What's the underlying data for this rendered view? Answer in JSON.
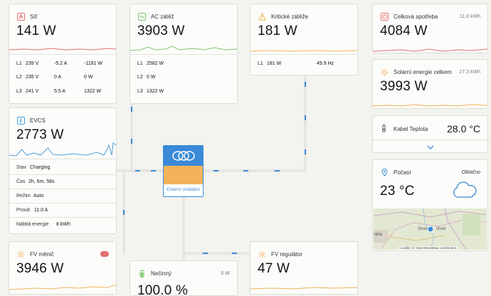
{
  "grid": {
    "title": "Síť",
    "value": "141 W",
    "rows": [
      {
        "phase": "L1",
        "volt": "239 V",
        "amp": "-5.2 A",
        "watt": "-1181 W"
      },
      {
        "phase": "L2",
        "volt": "235 V",
        "amp": "0 A",
        "watt": "0 W"
      },
      {
        "phase": "L3",
        "volt": "241 V",
        "amp": "5.5 A",
        "watt": "1322 W"
      }
    ]
  },
  "ac_load": {
    "title": "AC zátěž",
    "value": "3903 W",
    "rows": [
      {
        "phase": "L1",
        "watt": "2582 W"
      },
      {
        "phase": "L2",
        "watt": "0 W"
      },
      {
        "phase": "L3",
        "watt": "1322 W"
      }
    ]
  },
  "critical_load": {
    "title": "Kritické zátěže",
    "value": "181 W",
    "rows": [
      {
        "phase": "L1",
        "watt": "181 W",
        "freq": "49.9 Hz"
      }
    ]
  },
  "total_consumption": {
    "title": "Celková spotřeba",
    "value": "4084 W",
    "energy": "11.8 kWh"
  },
  "solar_total": {
    "title": "Solární energie celkem",
    "value": "3993 W",
    "energy": "27.3 kWh"
  },
  "cable_temp": {
    "title": "Kabel Teplota",
    "value": "28.0 °C"
  },
  "weather": {
    "title": "Počasí",
    "condition": "Oblačno",
    "temp": "23 °C",
    "map_attrib": "Leaflet | © OpenStreetMap contributors",
    "map_labels": [
      "raha",
      "Seve",
      "chod"
    ]
  },
  "evcs": {
    "title": "EVCS",
    "value": "2773 W",
    "rows": [
      {
        "label": "Stav",
        "value": "Charging"
      },
      {
        "label": "Čas",
        "value": "2h, 6m, 58s"
      },
      {
        "label": "Režim",
        "value": "Auto"
      },
      {
        "label": "Proud",
        "value": "11.0 A"
      },
      {
        "label": "Nabitá energie",
        "value": "8 kWh"
      }
    ]
  },
  "pv_inverter": {
    "title": "FV měnič",
    "value": "3946 W"
  },
  "pv_charger": {
    "title": "FV regulátor",
    "value": "47 W"
  },
  "inactive": {
    "title": "Nečinný",
    "value": "100.0 %",
    "power": "0 W"
  },
  "inverter": {
    "label": "Externí ovládání"
  },
  "colors": {
    "accent": "#3a8ad8",
    "grid": "#e0706e",
    "ac": "#7bc66d",
    "solar": "#f2b35a",
    "evcs": "#4a9ee0"
  }
}
